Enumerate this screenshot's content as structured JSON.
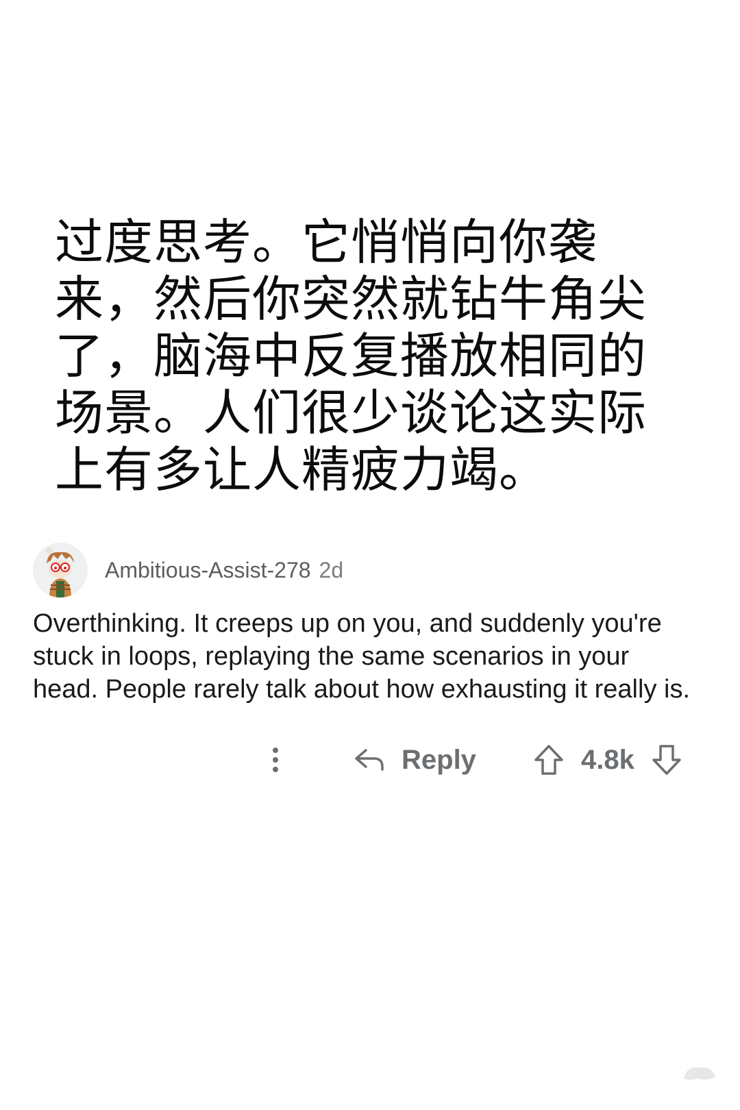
{
  "post": {
    "translation_text": "过度思考。它悄悄向你袭来，然后你突然就钻牛角尖了，脑海中反复播放相同的场景。人们很少谈论这实际上有多让人精疲力竭。"
  },
  "comment": {
    "username": "Ambitious-Assist-278",
    "timestamp": "2d",
    "body": "Overthinking. It creeps up on you, and suddenly you're stuck in loops, replaying the same scenarios in your head. People rarely talk about how exhausting it really is.",
    "avatar_icon": "snoo-avatar-icon"
  },
  "actions": {
    "more_icon": "more-vertical-icon",
    "reply_icon": "reply-arrow-icon",
    "reply_label": "Reply",
    "upvote_icon": "upvote-arrow-icon",
    "vote_count": "4.8k",
    "downvote_icon": "downvote-arrow-icon"
  },
  "colors": {
    "text_primary": "#1a1a1b",
    "text_muted": "#6c6f72",
    "background": "#ffffff"
  }
}
